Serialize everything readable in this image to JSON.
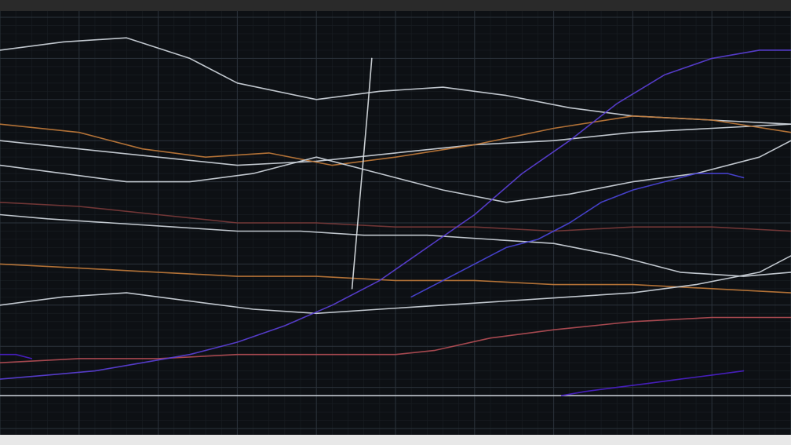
{
  "chart_data": {
    "type": "line",
    "title": "",
    "xlabel": "",
    "ylabel": "",
    "grid": true,
    "x_tick_labels": [
      "",
      "",
      "",
      "",
      "",
      "",
      ""
    ],
    "xlim": [
      0,
      100
    ],
    "ylim": [
      0,
      100
    ],
    "series": [
      {
        "color": "#cfd6dd",
        "x": [
          0,
          8,
          16,
          24,
          30,
          40,
          48,
          56,
          64,
          72,
          80,
          90,
          100
        ],
        "y": [
          92,
          94,
          95,
          90,
          84,
          80,
          82,
          83,
          81,
          78,
          76,
          75,
          74
        ]
      },
      {
        "color": "#cfd6dd",
        "x": [
          0,
          10,
          20,
          30,
          40,
          50,
          60,
          70,
          80,
          90,
          100
        ],
        "y": [
          70,
          68,
          66,
          64,
          65,
          67,
          69,
          70,
          72,
          73,
          74
        ]
      },
      {
        "color": "#c07a3a",
        "x": [
          0,
          10,
          18,
          26,
          34,
          42,
          50,
          60,
          70,
          80,
          90,
          100
        ],
        "y": [
          74,
          72,
          68,
          66,
          67,
          64,
          66,
          69,
          73,
          76,
          75,
          72
        ]
      },
      {
        "color": "#cfd6dd",
        "x": [
          0,
          8,
          16,
          24,
          32,
          40,
          48,
          56,
          64,
          72,
          80,
          88,
          96,
          100
        ],
        "y": [
          64,
          62,
          60,
          60,
          62,
          66,
          62,
          58,
          55,
          57,
          60,
          62,
          66,
          70
        ]
      },
      {
        "color": "#7a3a3a",
        "x": [
          0,
          10,
          20,
          30,
          40,
          50,
          60,
          70,
          80,
          90,
          100
        ],
        "y": [
          55,
          54,
          52,
          50,
          50,
          49,
          49,
          48,
          49,
          49,
          48
        ]
      },
      {
        "color": "#cfd6dd",
        "x": [
          0,
          6,
          14,
          22,
          30,
          38,
          46,
          54,
          62,
          70,
          78,
          86,
          94,
          100
        ],
        "y": [
          52,
          51,
          50,
          49,
          48,
          48,
          47,
          47,
          46,
          45,
          42,
          38,
          37,
          38
        ]
      },
      {
        "color": "#c07a3a",
        "x": [
          0,
          10,
          20,
          30,
          40,
          50,
          60,
          70,
          80,
          90,
          100
        ],
        "y": [
          40,
          39,
          38,
          37,
          37,
          36,
          36,
          35,
          35,
          34,
          33
        ]
      },
      {
        "color": "#cfd6dd",
        "x": [
          0,
          8,
          16,
          24,
          32,
          40,
          48,
          56,
          64,
          72,
          80,
          88,
          96,
          100
        ],
        "y": [
          30,
          32,
          33,
          31,
          29,
          28,
          29,
          30,
          31,
          32,
          33,
          35,
          38,
          42
        ]
      },
      {
        "color": "#b34d55",
        "x": [
          0,
          10,
          20,
          30,
          40,
          50,
          55,
          62,
          70,
          80,
          90,
          100
        ],
        "y": [
          16,
          17,
          17,
          18,
          18,
          18,
          19,
          22,
          24,
          26,
          27,
          27
        ]
      },
      {
        "color": "#cfd6dd",
        "x": [
          0,
          10,
          20,
          30,
          40,
          50,
          60,
          70,
          80,
          90,
          100
        ],
        "y": [
          8,
          8,
          8,
          8,
          8,
          8,
          8,
          8,
          8,
          8,
          8
        ]
      },
      {
        "color": "#5a3fd6",
        "x": [
          0,
          6,
          12,
          18,
          24,
          30,
          36,
          42,
          48,
          54,
          60,
          66,
          72,
          78,
          84,
          90,
          96,
          100
        ],
        "y": [
          12,
          13,
          14,
          16,
          18,
          21,
          25,
          30,
          36,
          44,
          52,
          62,
          70,
          79,
          86,
          90,
          92,
          92
        ]
      },
      {
        "color": "#4a44d8",
        "x": [
          52,
          56,
          60,
          64,
          68,
          72,
          76,
          80,
          84,
          88,
          92,
          94
        ],
        "y": [
          32,
          36,
          40,
          44,
          46,
          50,
          55,
          58,
          60,
          62,
          62,
          61
        ]
      },
      {
        "color": "#4a1fc8",
        "x": [
          0,
          2,
          4
        ],
        "y": [
          18,
          18,
          17
        ]
      },
      {
        "color": "#4a1fc8",
        "x": [
          71,
          74,
          78,
          82,
          86,
          90,
          94
        ],
        "y": [
          8,
          9,
          10,
          11,
          12,
          13,
          14
        ]
      },
      {
        "color": "#d8dde2",
        "x": [
          44.5,
          45.0,
          45.5,
          46.0,
          46.5,
          47.0
        ],
        "y": [
          34,
          45,
          56,
          67,
          78,
          90
        ]
      }
    ]
  }
}
